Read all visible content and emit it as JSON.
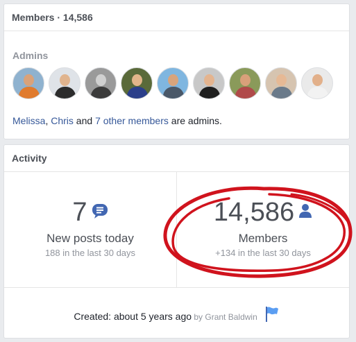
{
  "members_card": {
    "title": "Members · 14,586",
    "admins_label": "Admins",
    "admins": [
      {
        "name": "admin-1",
        "bg": "#8fb2cf",
        "skin": "#d9a27a",
        "shirt": "#e07b2e"
      },
      {
        "name": "admin-2",
        "bg": "#dfe3e8",
        "skin": "#e0b48e",
        "shirt": "#2c2c2c"
      },
      {
        "name": "admin-3",
        "bg": "#9a9a9a",
        "skin": "#d0d0d0",
        "shirt": "#3b3b3b"
      },
      {
        "name": "admin-4",
        "bg": "#5a6a3a",
        "skin": "#e2b58a",
        "shirt": "#2b3f8a"
      },
      {
        "name": "admin-5",
        "bg": "#7fb6e0",
        "skin": "#d8a47c",
        "shirt": "#4a5868"
      },
      {
        "name": "admin-6",
        "bg": "#c8c8c8",
        "skin": "#e4b48f",
        "shirt": "#1f1f1f"
      },
      {
        "name": "admin-7",
        "bg": "#8a9a5a",
        "skin": "#d9a07a",
        "shirt": "#b04a4a"
      },
      {
        "name": "admin-8",
        "bg": "#d6c4b0",
        "skin": "#e6b995",
        "shirt": "#6a7a8a"
      },
      {
        "name": "admin-9",
        "bg": "#eaeaea",
        "skin": "#e2b08a",
        "shirt": "#f2f2f2"
      }
    ],
    "admins_text": {
      "name1": "Melissa",
      "sep1": ", ",
      "name2": "Chris",
      "mid": " and ",
      "others": "7 other members",
      "end": " are admins."
    }
  },
  "activity_card": {
    "title": "Activity",
    "posts": {
      "number": "7",
      "label": "New posts today",
      "sub": "188 in the last 30 days"
    },
    "members": {
      "number": "14,586",
      "label": "Members",
      "sub": "+134 in the last 30 days"
    },
    "created": {
      "text": "Created: about 5 years ago",
      "by": " by Grant Baldwin"
    }
  },
  "colors": {
    "accent": "#4267b2",
    "annotation": "#d0131d"
  }
}
